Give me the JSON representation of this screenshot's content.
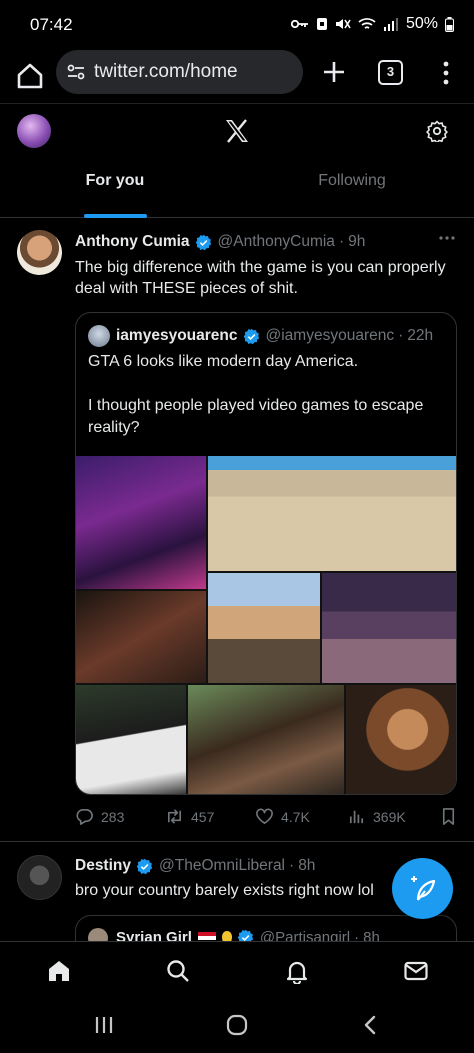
{
  "status_bar": {
    "time": "07:42",
    "battery": "50%",
    "icons": [
      "key-icon",
      "lock-notification-icon",
      "mute-icon",
      "wifi-icon",
      "signal-icon",
      "battery-icon"
    ]
  },
  "browser": {
    "url": "twitter.com/home",
    "tab_count": "3"
  },
  "header": {
    "tabs": [
      {
        "label": "For you",
        "active": true
      },
      {
        "label": "Following",
        "active": false
      }
    ]
  },
  "tweet1": {
    "name": "Anthony Cumia",
    "handle": "@AnthonyCumia",
    "separator": "·",
    "time": "9h",
    "text": "The big difference with the game is you can properly deal with THESE pieces of shit.",
    "quote": {
      "name": "iamyesyouarenc",
      "handle": "@iamyesyouarenc",
      "separator": "·",
      "time": "22h",
      "text_line1": "GTA 6 looks like modern day America.",
      "text_line2": "I thought people played video games to escape reality?"
    },
    "stats": {
      "replies": "283",
      "retweets": "457",
      "likes": "4.7K",
      "views": "369K"
    }
  },
  "tweet2": {
    "name": "Destiny",
    "handle": "@TheOmniLiberal",
    "separator": "·",
    "time": "8h",
    "text": "bro your country barely exists right now lol",
    "quote": {
      "name": "Syrian Girl",
      "handle": "@Partisangirl",
      "separator": "·",
      "time": "8h"
    }
  },
  "colors": {
    "accent": "#1d9bf0",
    "background": "#000000",
    "text_primary": "#e7e9ea",
    "text_secondary": "#71767b",
    "border": "#2f3336"
  }
}
